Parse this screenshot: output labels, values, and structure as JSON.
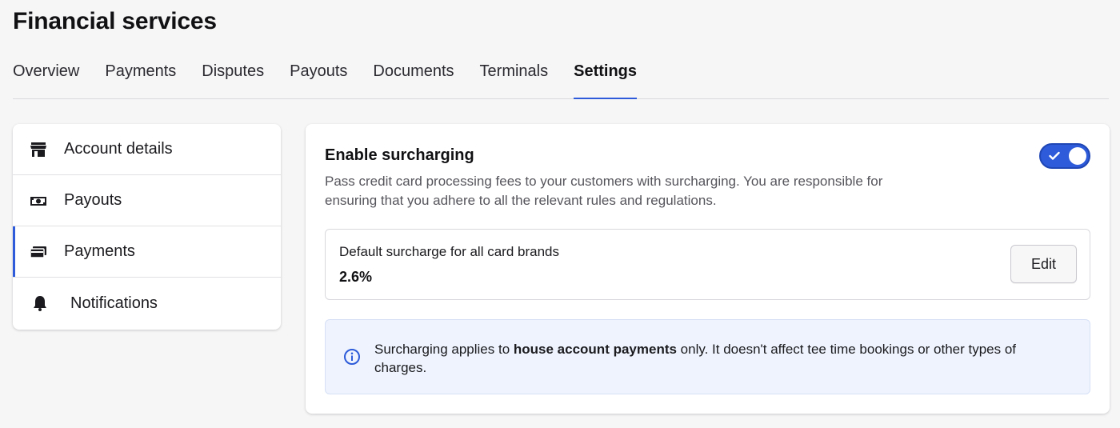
{
  "page_title": "Financial services",
  "tabs": [
    {
      "label": "Overview",
      "active": false
    },
    {
      "label": "Payments",
      "active": false
    },
    {
      "label": "Disputes",
      "active": false
    },
    {
      "label": "Payouts",
      "active": false
    },
    {
      "label": "Documents",
      "active": false
    },
    {
      "label": "Terminals",
      "active": false
    },
    {
      "label": "Settings",
      "active": true
    }
  ],
  "sidebar": {
    "items": [
      {
        "label": "Account details",
        "icon": "store-icon",
        "active": false
      },
      {
        "label": "Payouts",
        "icon": "cash-icon",
        "active": false
      },
      {
        "label": "Payments",
        "icon": "credit-card-icon",
        "active": true
      },
      {
        "label": "Notifications",
        "icon": "bell-icon",
        "active": false
      }
    ]
  },
  "surcharging": {
    "title": "Enable surcharging",
    "description": "Pass credit card processing fees to your customers with surcharging. You are responsible for ensuring that you adhere to all the relevant rules and regulations.",
    "enabled": true,
    "default_label": "Default surcharge for all card brands",
    "default_value": "2.6%",
    "edit_label": "Edit",
    "info": {
      "prefix": "Surcharging applies to ",
      "bold": "house account payments",
      "suffix": " only. It doesn't affect tee time bookings or other types of charges."
    }
  },
  "colors": {
    "accent": "#2d5bd9",
    "info_bg": "#eef3fd",
    "info_icon": "#2d5bd9"
  }
}
